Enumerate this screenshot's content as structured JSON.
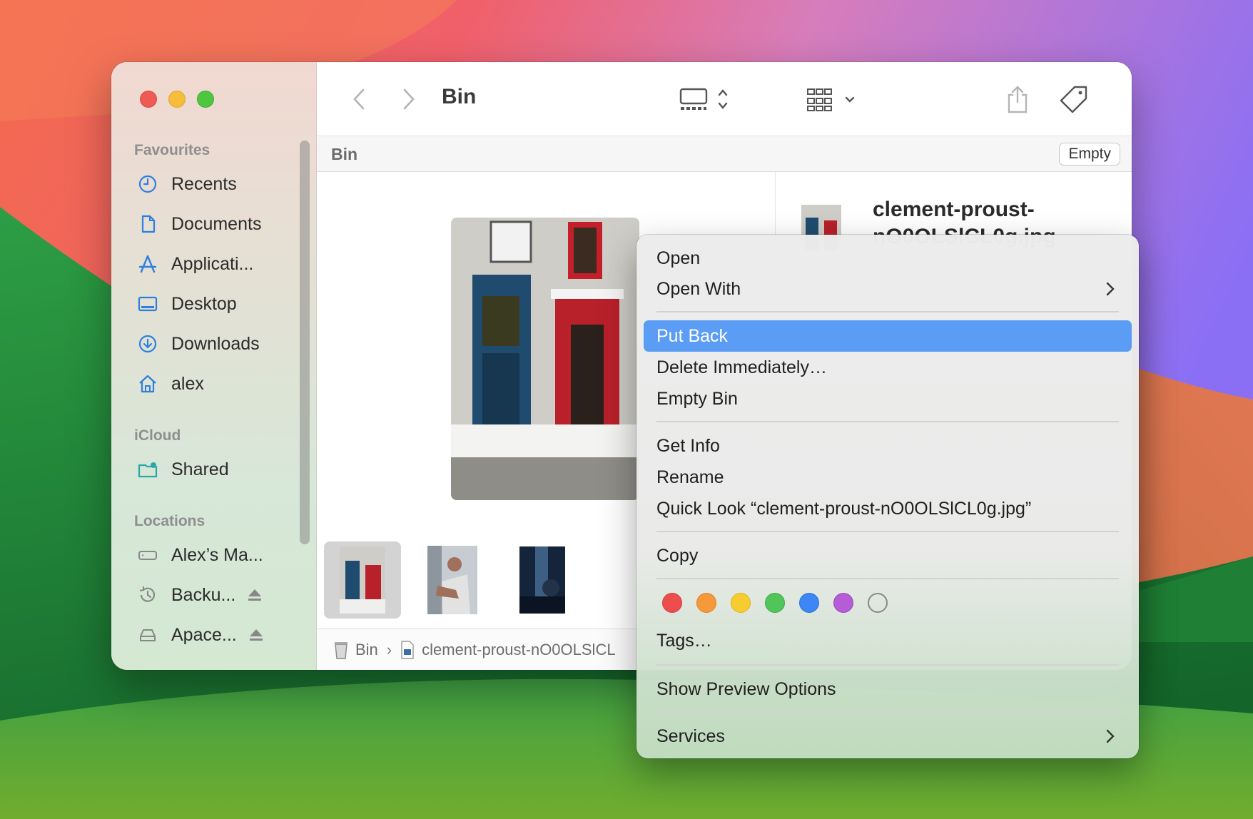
{
  "window": {
    "title": "Bin",
    "favourites_header": "Favourites",
    "icloud_header": "iCloud",
    "locations_header": "Locations"
  },
  "sidebar": {
    "favourites": [
      {
        "label": "Recents",
        "icon": "clock-icon"
      },
      {
        "label": "Documents",
        "icon": "document-icon"
      },
      {
        "label": "Applicati...",
        "icon": "applications-icon"
      },
      {
        "label": "Desktop",
        "icon": "desktop-icon"
      },
      {
        "label": "Downloads",
        "icon": "download-icon"
      },
      {
        "label": "alex",
        "icon": "home-icon"
      }
    ],
    "icloud": [
      {
        "label": "Shared",
        "icon": "shared-folder-icon"
      }
    ],
    "locations": [
      {
        "label": "Alex’s Ma...",
        "icon": "laptop-icon"
      },
      {
        "label": "Backu...",
        "icon": "time-machine-icon"
      },
      {
        "label": "Apace...",
        "icon": "drive-icon"
      }
    ]
  },
  "pathbar": {
    "label": "Bin",
    "empty_button": "Empty"
  },
  "bottom_path": {
    "root": "Bin",
    "file": "clement-proust-nO0OLSlCL"
  },
  "inspector": {
    "name_line1": "clement-proust-",
    "name_line2": "nO0OLSlCL0g.jpg"
  },
  "context_menu": {
    "items": [
      "Open",
      "Open With",
      "Put Back",
      "Delete Immediately…",
      "Empty Bin",
      "Get Info",
      "Rename",
      "Quick Look “clement-proust-nO0OLSlCL0g.jpg”",
      "Copy",
      "Tags…",
      "Show Preview Options",
      "Services"
    ],
    "highlighted": "Put Back",
    "tag_colors": [
      "#ee4d4d",
      "#f5993a",
      "#f7cc2f",
      "#51c45a",
      "#3c86f5",
      "#b65cd6",
      "none"
    ]
  },
  "colors": {
    "accent": "#5b9cf5",
    "sidebar_icon": "#2d7fe0"
  }
}
